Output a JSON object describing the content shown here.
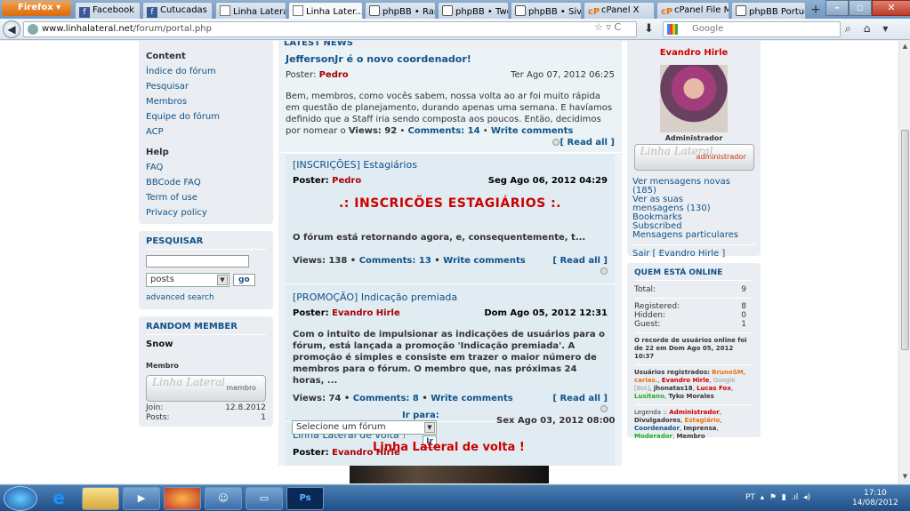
{
  "browser": {
    "app_button": "Firefox",
    "tabs": [
      {
        "label": "Facebook",
        "icon": "facebook-icon",
        "active": false
      },
      {
        "label": "Cutucadas",
        "icon": "facebook-icon",
        "active": false
      },
      {
        "label": "Linha Lateral •...",
        "icon": "page-icon",
        "active": false
      },
      {
        "label": "Linha Later...",
        "icon": "page-icon",
        "active": true
      },
      {
        "label": "phpBB • Rank...",
        "icon": "phpbb-icon",
        "active": false
      },
      {
        "label": "phpBB • Two ...",
        "icon": "phpbb-icon",
        "active": false
      },
      {
        "label": "phpBB • Sive ...",
        "icon": "phpbb-icon",
        "active": false
      },
      {
        "label": "cPanel X",
        "icon": "cpanel-icon",
        "active": false
      },
      {
        "label": "cPanel File M...",
        "icon": "cpanel-icon",
        "active": false
      },
      {
        "label": "phpBB Portug...",
        "icon": "phpbb-icon",
        "active": false
      }
    ],
    "new_tab": "+",
    "tab_close": "×",
    "url_host": "www.linhalateral.net",
    "url_path": "/forum/portal.php",
    "url_tools": "☆ ▿ C",
    "search_placeholder": "Google",
    "window_min": "–",
    "window_max": "▫",
    "window_close": "✕"
  },
  "left": {
    "content_title": "Content",
    "content_links": [
      "Índice do fórum",
      "Pesquisar",
      "Membros",
      "Equipe do fórum",
      "ACP"
    ],
    "help_title": "Help",
    "help_links": [
      "FAQ",
      "BBCode FAQ",
      "Term of use",
      "Privacy policy"
    ],
    "search_title": "PESQUISAR",
    "search_select": "posts",
    "search_go": "go",
    "advanced": "advanced search",
    "random_title": "RANDOM MEMBER",
    "random_name": "Snow",
    "random_rank": "Membro",
    "random_rank_img_text": "membro",
    "random_sig": "Linha Lateral",
    "join_label": "Join:",
    "join_value": "12.8.2012",
    "posts_label": "Posts:",
    "posts_value": "1"
  },
  "main": {
    "header": "LATEST NEWS",
    "posts": [
      {
        "title": "JeffersonJr é o novo coordenador!",
        "author_label": "Poster:",
        "author": "Pedro",
        "date": "Ter Ago 07, 2012 06:25",
        "text": "Bem, membros, como vocês sabem, nossa volta ao ar foi muito rápida em questão de planejamento, durando apenas uma semana. E havíamos definido que a Staff iria sendo composta aos poucos. Então, decidimos por nomear o",
        "views_label": "Views:",
        "views": "92",
        "comments_label": "Comments:",
        "comments": "14",
        "write": "Write comments",
        "read_all": "[ Read all ]"
      },
      {
        "title": "[INSCRIÇÕES] Estagiários",
        "author_label": "Poster:",
        "author": "Pedro",
        "date": "Seg Ago 06, 2012 04:29",
        "headline": ".: INSCRICÕES ESTAGIÁRIOS :.",
        "text": "O fórum está retornando agora, e, consequentemente, t...",
        "views_label": "Views:",
        "views": "138",
        "comments_label": "Comments:",
        "comments": "13",
        "write": "Write comments",
        "read_all": "[ Read all ]"
      },
      {
        "title": "[PROMOÇÃO] Indicação premiada",
        "author_label": "Poster:",
        "author": "Evandro Hirle",
        "date": "Dom Ago 05, 2012 12:31",
        "text": "Com o intuito de impulsionar as indicações de usuários para o fórum, está lançada a promoção 'Indicação premiada'. A promoção é simples e consiste em trazer o maior número de membros para o fórum. O membro que, nas próximas 24 horas, ...",
        "views_label": "Views:",
        "views": "74",
        "comments_label": "Comments:",
        "comments": "8",
        "write": "Write comments",
        "read_all": "[ Read all ]"
      },
      {
        "title": "Linha Lateral de volta !",
        "author_label": "Poster:",
        "author": "Evandro Hirle",
        "date": "Sex Ago 03, 2012 08:00"
      }
    ],
    "jump_label": "Ir para:",
    "jump_select": "Selecione um fórum",
    "jump_go": "Ir",
    "bottom_title": "Linha Lateral de volta !"
  },
  "right": {
    "username": "Evandro Hirle",
    "role": "Administrador",
    "rank_img_text": "administrador",
    "sig": "Linha Lateral",
    "links": [
      "Ver mensagens novas (185)",
      "Ver as suas",
      "mensagens (130)",
      "Bookmarks",
      "Subscribed",
      "Mensagens particulares"
    ],
    "logout": "Sair [ Evandro Hirle ]",
    "online_title": "QUEM ESTÁ ONLINE",
    "total_label": "Total:",
    "total": "9",
    "registered_label": "Registered:",
    "registered": "8",
    "hidden_label": "Hidden:",
    "hidden": "0",
    "guest_label": "Guest:",
    "guest": "1",
    "record": "O recorde de usuários online foi de 22 em Dom Ago 05, 2012 10:37",
    "registered_users_label": "Usuários registrados:",
    "users": [
      {
        "name": "BrunoSM",
        "color": "orange"
      },
      {
        "name": "carias.",
        "color": "orange"
      },
      {
        "name": "Evandro Hirle",
        "color": "red"
      },
      {
        "name": "Google [Bot]",
        "color": "gray"
      },
      {
        "name": "jhonatas18",
        "color": "default"
      },
      {
        "name": "Lucas Fox",
        "color": "red"
      },
      {
        "name": "Lusitano",
        "color": "green"
      },
      {
        "name": "Tyko Morales",
        "color": "default"
      }
    ],
    "legend_label": "Legenda ::",
    "legend": [
      {
        "name": "Administrador",
        "color": "red"
      },
      {
        "name": "Divulgadores",
        "color": "default"
      },
      {
        "name": "Estagiário",
        "color": "orange"
      },
      {
        "name": "Coordenador",
        "color": "blue"
      },
      {
        "name": "Imprensa",
        "color": "default"
      },
      {
        "name": "Moderador",
        "color": "green"
      },
      {
        "name": "Membro",
        "color": "default"
      }
    ]
  },
  "taskbar": {
    "lang": "PT",
    "time": "17:10",
    "date": "14/08/2012",
    "ps_label": "Ps"
  },
  "colors": {
    "accent": "#105289",
    "red": "#cc0000",
    "orange": "#e8700b",
    "green": "#22aa22"
  }
}
